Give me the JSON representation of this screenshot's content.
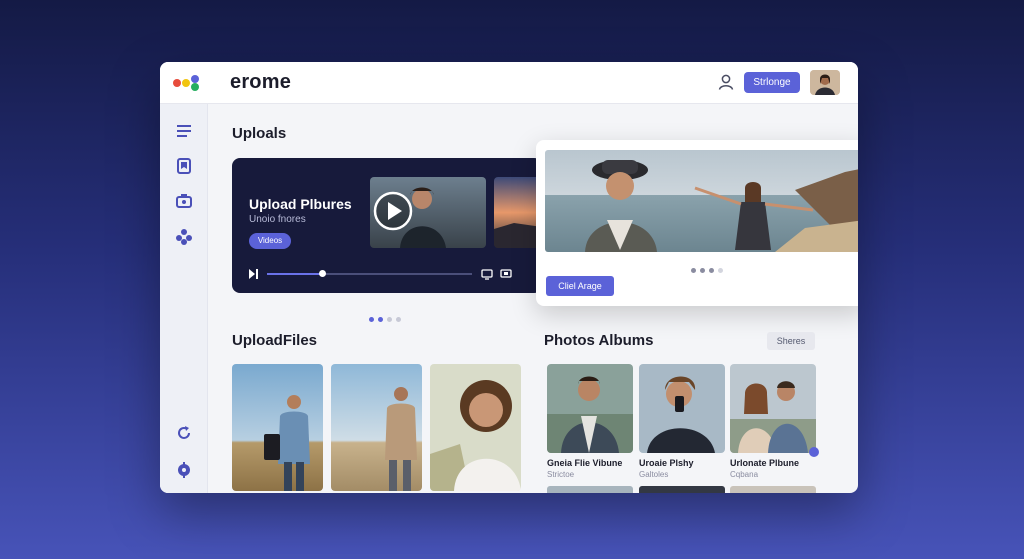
{
  "app": {
    "brand": "erome",
    "storage_button": "Strlonge",
    "dots": [
      "#e74c3c",
      "#f1c40f",
      "#5b62d8",
      "#27ae60"
    ],
    "accent": "#5b62d8"
  },
  "sidebar": {
    "items": [
      {
        "icon": "list-icon"
      },
      {
        "icon": "bookmark-icon"
      },
      {
        "icon": "camera-icon"
      },
      {
        "icon": "apps-icon"
      },
      {
        "icon": "refresh-icon"
      },
      {
        "icon": "settings-icon"
      }
    ]
  },
  "uploads": {
    "title": "Uploals",
    "hero": {
      "title": "Upload Plbures",
      "subtitle": "Unoio fnores",
      "badge": "Videos",
      "progress": 0.27
    },
    "pager_active": 0,
    "pager_count": 4
  },
  "popup": {
    "button": "Cliel Arage",
    "pager_active": 1,
    "pager_count": 4
  },
  "upload_files": {
    "title": "UploadFiles"
  },
  "albums": {
    "title": "Photos Albums",
    "shares_button": "Sheres",
    "items": [
      {
        "title": "Gneia Flie Vibune",
        "subtitle": "Strictoe"
      },
      {
        "title": "Uroaie Plshy",
        "subtitle": "Galtoles"
      },
      {
        "title": "Urlonate Plbune",
        "subtitle": "Cqbana"
      }
    ]
  }
}
